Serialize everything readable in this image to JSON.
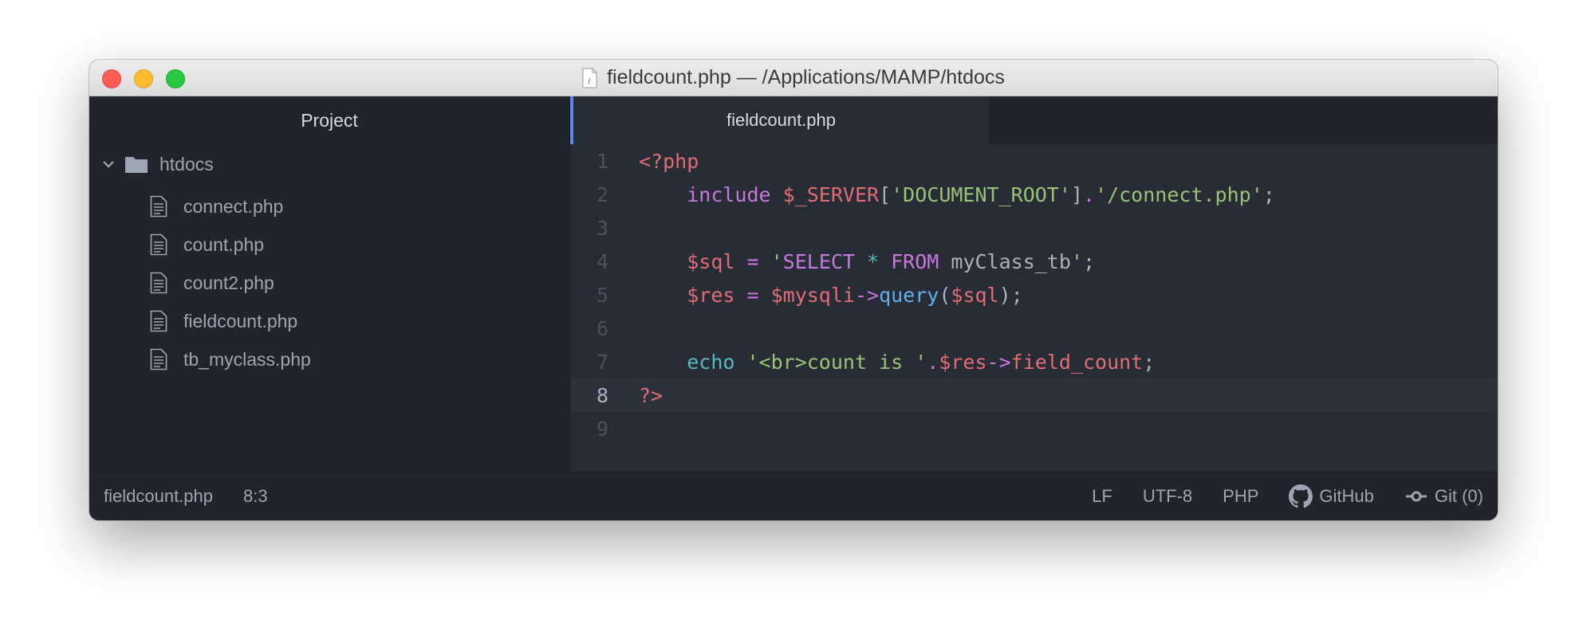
{
  "window": {
    "title": "fieldcount.php — /Applications/MAMP/htdocs"
  },
  "sidebar": {
    "header": "Project",
    "root_folder": "htdocs",
    "files": [
      "connect.php",
      "count.php",
      "count2.php",
      "fieldcount.php",
      "tb_myclass.php"
    ]
  },
  "editor": {
    "active_tab": "fieldcount.php",
    "line_numbers": [
      "1",
      "2",
      "3",
      "4",
      "5",
      "6",
      "7",
      "8",
      "9"
    ],
    "current_line": 8
  },
  "code": {
    "l1_open": "<?php",
    "l2_include": "include",
    "l2_server": "$_SERVER",
    "l2_lb": "[",
    "l2_key": "'DOCUMENT_ROOT'",
    "l2_rb": "]",
    "l2_dot": ".",
    "l2_path": "'/connect.php'",
    "l2_semi": ";",
    "l4_var": "$sql",
    "l4_eq": " = ",
    "l4_q1": "'",
    "l4_select": "SELECT",
    "l4_star": " * ",
    "l4_from": "FROM",
    "l4_rest": " myClass_tb",
    "l4_q2": "'",
    "l4_semi": ";",
    "l5_var": "$res",
    "l5_eq": " = ",
    "l5_mysqli": "$mysqli",
    "l5_arrow": "->",
    "l5_query": "query",
    "l5_lp": "(",
    "l5_sql": "$sql",
    "l5_rp": ");",
    "l7_echo": "echo",
    "l7_str": " '<br>count is '",
    "l7_dot": ".",
    "l7_res": "$res",
    "l7_arrow": "->",
    "l7_prop": "field_count",
    "l7_semi": ";",
    "l8_close": "?>"
  },
  "status": {
    "file": "fieldcount.php",
    "cursor": "8:3",
    "line_ending": "LF",
    "encoding": "UTF-8",
    "grammar": "PHP",
    "github": "GitHub",
    "git": "Git (0)"
  },
  "colors": {
    "accent": "#568af2",
    "background": "#282c34",
    "sidebar": "#21252b"
  }
}
